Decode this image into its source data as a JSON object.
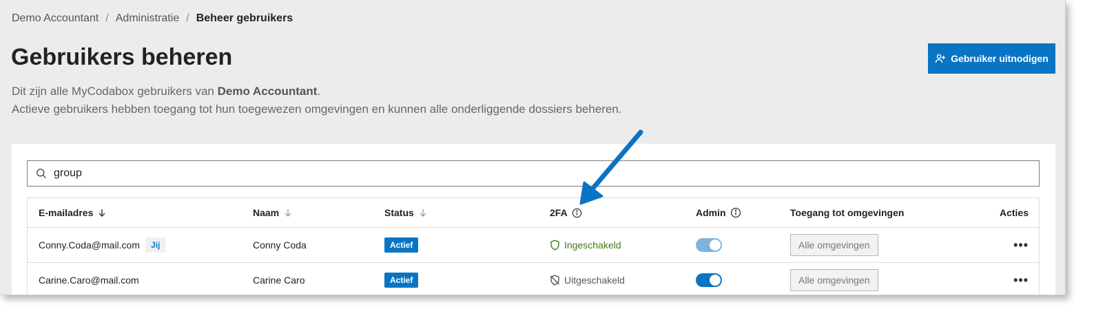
{
  "breadcrumb": [
    "Demo Accountant",
    "Administratie",
    "Beheer gebruikers"
  ],
  "page": {
    "title": "Gebruikers beheren",
    "desc_line1_prefix": "Dit zijn alle MyCodabox gebruikers van ",
    "desc_line1_bold": "Demo Accountant",
    "desc_line1_suffix": ".",
    "desc_line2": "Actieve gebruikers hebben toegang tot hun toegewezen omgevingen en kunnen alle onderliggende dossiers beheren."
  },
  "invite_button": {
    "label": "Gebruiker uitnodigen",
    "icon": "user-plus-icon"
  },
  "search": {
    "value": "group"
  },
  "table": {
    "headers": {
      "email": "E-mailadres",
      "naam": "Naam",
      "status": "Status",
      "tfa": "2FA",
      "admin": "Admin",
      "toegang": "Toegang tot omgevingen",
      "acties": "Acties"
    },
    "rows": [
      {
        "email": "Conny.Coda@mail.com",
        "tag": "Jij",
        "naam": "Conny Coda",
        "status": "Actief",
        "tfa": "Ingeschakeld",
        "tfa_icon": "shield-icon",
        "admin": true,
        "admin_disabled": true,
        "toegang": "Alle omgevingen",
        "acties": "•••"
      },
      {
        "email": "Carine.Caro@mail.com",
        "naam": "Carine Caro",
        "status": "Actief",
        "tfa": "Uitgeschakeld",
        "tfa_icon": "shield-off-icon",
        "admin": true,
        "admin_disabled": false,
        "toegang": "Alle omgevingen",
        "acties": "•••"
      }
    ]
  },
  "colors": {
    "accent": "#0a74c4",
    "tfa_on": "#3d7a13",
    "arrow": "#0a74c4"
  }
}
